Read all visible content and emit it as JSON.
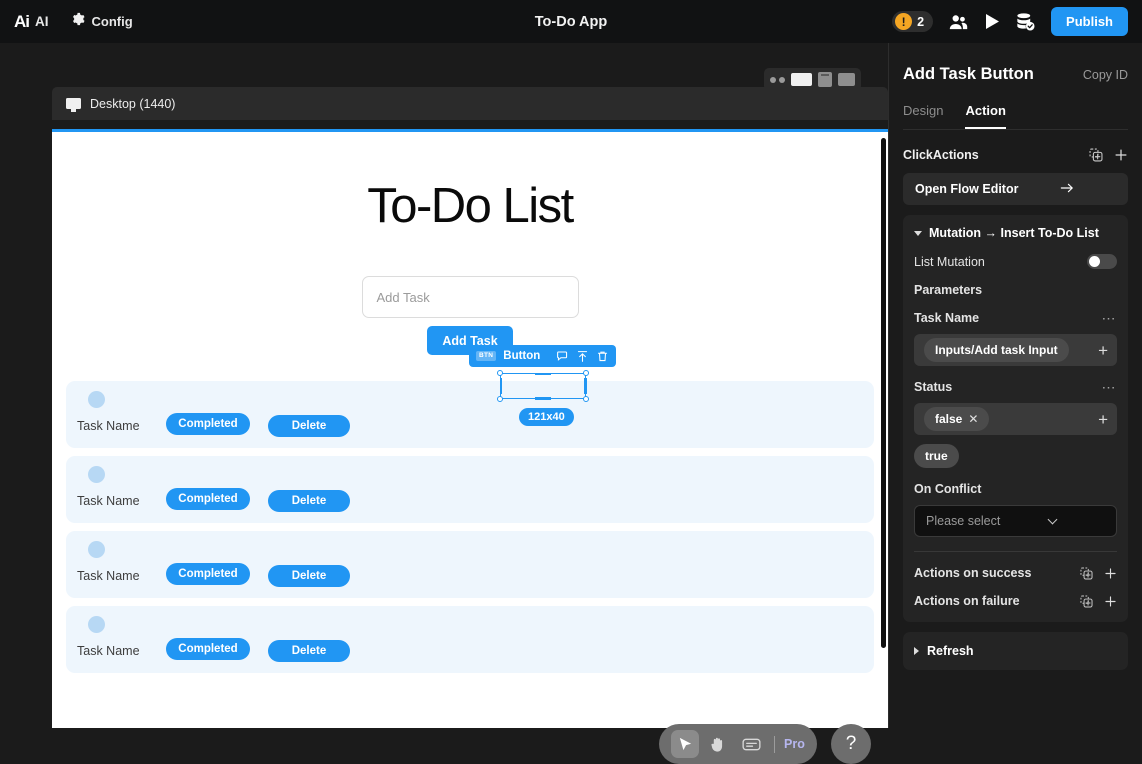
{
  "topbar": {
    "logo_mark": "Ai",
    "logo_text": "AI",
    "config_label": "Config",
    "app_title": "To-Do App",
    "warning_count": "2",
    "warning_icon": "warning-icon",
    "team_icon": "people-icon",
    "preview_icon": "play-icon",
    "database_icon": "database-check-icon",
    "publish_label": "Publish"
  },
  "canvas": {
    "frame_label": "Desktop (1440)",
    "frame_icon": "monitor-icon",
    "devices": [
      "dots-icon",
      "desktop-icon",
      "tablet-icon",
      "phone-icon"
    ],
    "artboard": {
      "title": "To-Do List",
      "input_placeholder": "Add Task",
      "add_button_label": "Add Task",
      "tasks": [
        {
          "name": "Task Name",
          "completed_label": "Completed",
          "delete_label": "Delete"
        },
        {
          "name": "Task Name",
          "completed_label": "Completed",
          "delete_label": "Delete"
        },
        {
          "name": "Task Name",
          "completed_label": "Completed",
          "delete_label": "Delete"
        },
        {
          "name": "Task Name",
          "completed_label": "Completed",
          "delete_label": "Delete"
        }
      ]
    },
    "selection": {
      "badge": "BTN",
      "type_label": "Button",
      "comment_icon": "comment-icon",
      "move_up_icon": "arrow-up-icon",
      "delete_icon": "trash-icon",
      "size_label": "121x40"
    }
  },
  "bottom_tools": {
    "cursor_icon": "cursor-icon",
    "hand_icon": "hand-icon",
    "comment_icon": "comment-box-icon",
    "pro_label": "Pro",
    "help_label": "?"
  },
  "panel": {
    "title": "Add Task Button",
    "copy_id": "Copy ID",
    "tabs": [
      {
        "label": "Design",
        "active": false
      },
      {
        "label": "Action",
        "active": true
      }
    ],
    "click_actions": {
      "title": "ClickActions",
      "duplicate_icon": "duplicate-icon",
      "add_icon": "plus-icon",
      "flow_editor_label": "Open Flow Editor",
      "flow_arrow_icon": "arrow-right-icon"
    },
    "mutation": {
      "title": "Mutation → Insert To-Do List",
      "list_mutation_label": "List Mutation",
      "list_mutation_on": false,
      "parameters_label": "Parameters",
      "task_name_label": "Task Name",
      "task_name_chip": "Inputs/Add task Input",
      "status_label": "Status",
      "status_chip": "false",
      "status_suggestion": "true",
      "on_conflict_label": "On Conflict",
      "on_conflict_value": "Please select",
      "actions_on_success": "Actions on success",
      "actions_on_failure": "Actions on failure"
    },
    "refresh": {
      "title": "Refresh"
    }
  },
  "colors": {
    "accent": "#2196f3",
    "warning": "#f5a623",
    "panel_bg": "#1b1b1b",
    "row_bg": "#eef6fd"
  }
}
